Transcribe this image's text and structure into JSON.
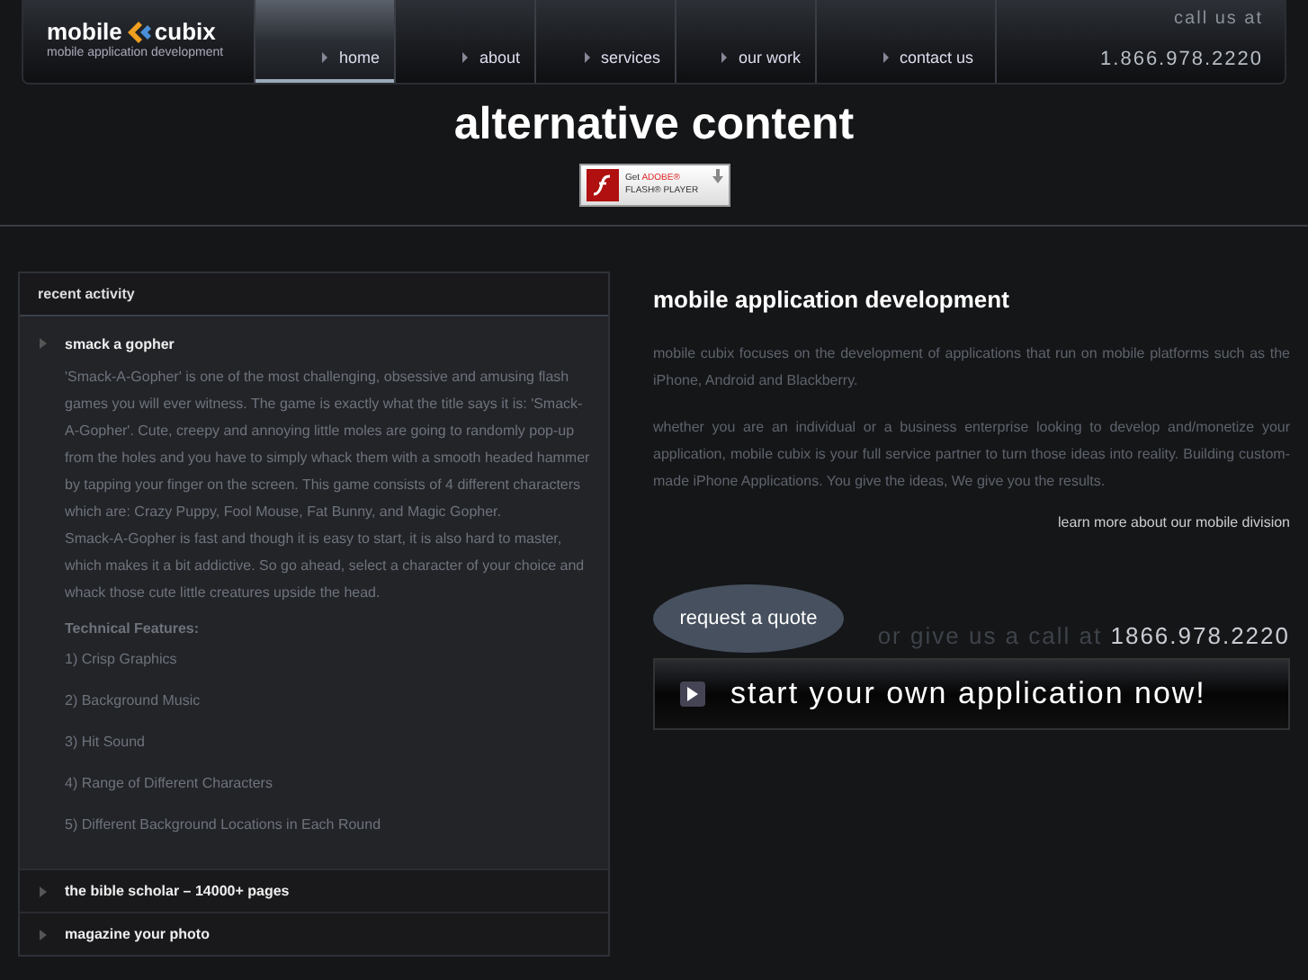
{
  "logo": {
    "name_left": "mobile",
    "name_right": "cubix",
    "tagline": "mobile application development"
  },
  "nav": [
    {
      "label": "home",
      "selected": true
    },
    {
      "label": "about",
      "selected": false
    },
    {
      "label": "services",
      "selected": false
    },
    {
      "label": "our work",
      "selected": false
    },
    {
      "label": "contact us",
      "selected": false
    }
  ],
  "call": {
    "label": "call us at",
    "phone": "1.866.978.2220"
  },
  "hero": {
    "title": "alternative content",
    "flash_badge": {
      "line1_prefix": "Get",
      "line1_brand": "ADOBE®",
      "line2": "FLASH® PLAYER"
    }
  },
  "recent_activity": {
    "title": "recent activity",
    "items": [
      {
        "title": "smack a gopher",
        "expanded": true,
        "paragraphs": [
          "'Smack-A-Gopher' is one of the most challenging, obsessive and amusing flash games you will ever witness. The game is exactly what the title says it is: 'Smack-A-Gopher'. Cute, creepy and annoying little moles are going to randomly pop-up from the holes and you have to simply whack them with a smooth headed hammer by tapping your finger on the screen. This game consists of 4 different characters which are: Crazy Puppy, Fool Mouse, Fat Bunny, and Magic Gopher.",
          "Smack-A-Gopher is fast and though it is easy to start, it is also hard to master, which makes it a bit addictive. So go ahead, select a character of your choice and whack those cute little creatures upside the head."
        ],
        "features_title": "Technical Features:",
        "features": [
          "1) Crisp Graphics",
          "2) Background Music",
          "3) Hit Sound",
          "4) Range of Different Characters",
          "5) Different Background Locations in Each Round"
        ]
      },
      {
        "title": "the bible scholar – 14000+ pages",
        "expanded": false
      },
      {
        "title": "magazine your photo",
        "expanded": false
      }
    ]
  },
  "about": {
    "title": "mobile application development",
    "paragraphs": [
      "mobile cubix focuses on the development of applications that run on mobile platforms such as the iPhone, Android and Blackberry.",
      "whether you are an individual or a business enterprise looking to develop and/monetize your application, mobile cubix is your full service partner to turn those ideas into reality. Building custom-made iPhone Applications. You give the ideas, We give you the results."
    ],
    "link": "learn more about our mobile division"
  },
  "cta": {
    "quote_button": "request a quote",
    "call_prefix": "or give us a call at",
    "call_phone": "1866.978.2220",
    "start_button": "start your own application now!"
  }
}
